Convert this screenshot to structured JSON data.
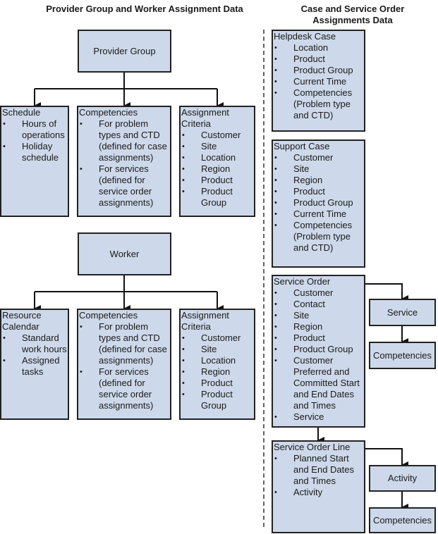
{
  "titles": {
    "left": "Provider Group and Worker Assignment Data",
    "right": "Case and Service Order Assignments Data"
  },
  "provider_group": {
    "label": "Provider Group",
    "schedule": {
      "heading": "Schedule",
      "items": [
        "Hours of operations",
        "Holiday schedule"
      ]
    },
    "competencies": {
      "heading": "Competencies",
      "items": [
        "For problem types and CTD (defined for case assignments)",
        "For services (defined for service order assignments)"
      ]
    },
    "assignment_criteria": {
      "heading": "Assignment Criteria",
      "items": [
        "Customer",
        "Site",
        "Location",
        "Region",
        "Product",
        "Product Group"
      ]
    }
  },
  "worker": {
    "label": "Worker",
    "resource_calendar": {
      "heading": "Resource Calendar",
      "items": [
        "Standard work hours",
        "Assigned tasks"
      ]
    },
    "competencies": {
      "heading": "Competencies",
      "items": [
        "For problem types and CTD (defined for case assignments)",
        "For services (defined for service order assignments)"
      ]
    },
    "assignment_criteria": {
      "heading": "Assignment Criteria",
      "items": [
        "Customer",
        "Site",
        "Location",
        "Region",
        "Product",
        "Product Group"
      ]
    }
  },
  "helpdesk_case": {
    "heading": "Helpdesk Case",
    "items": [
      "Location",
      "Product",
      "Product Group",
      "Current Time",
      "Competencies (Problem type and CTD)"
    ]
  },
  "support_case": {
    "heading": "Support Case",
    "items": [
      "Customer",
      "Site",
      "Region",
      "Product",
      "Product Group",
      "Current Time",
      "Competencies (Problem type and CTD)"
    ]
  },
  "service_order": {
    "heading": "Service Order",
    "items": [
      "Customer",
      "Contact",
      "Site",
      "Region",
      "Product",
      "Product Group",
      "Customer Preferred and Committed Start and End Dates and Times",
      "Service"
    ],
    "service_label": "Service",
    "competencies_label": "Competencies"
  },
  "service_order_line": {
    "heading": "Service Order Line",
    "items": [
      "Planned Start and End Dates and Times",
      "Activity"
    ],
    "activity_label": "Activity",
    "competencies_label": "Competencies"
  },
  "colors": {
    "box_fill": "#cdd9ea",
    "border": "#222222"
  }
}
